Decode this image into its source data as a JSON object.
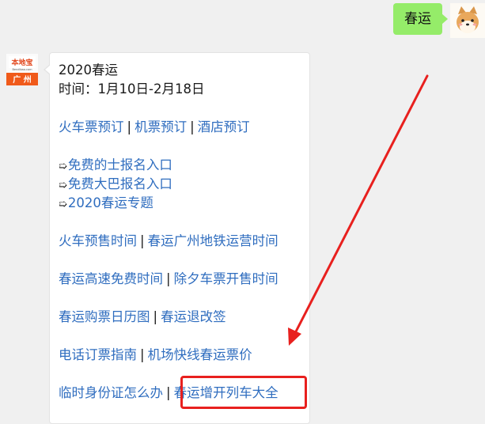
{
  "outgoing": {
    "text": "春运"
  },
  "bot_avatar": {
    "brand": "本地宝",
    "domain": "Bendibao.com",
    "city": "广 州"
  },
  "message": {
    "title": "2020春运",
    "date_line": "时间：1月10日-2月18日",
    "booking_links": [
      "火车票预订",
      "机票预订",
      "酒店预订"
    ],
    "separator": "|",
    "arrow_symbol": "➯",
    "entries": [
      "免费的士报名入口",
      "免费大巴报名入口",
      "2020春运专题"
    ],
    "link_rows": [
      [
        "火车预售时间",
        "春运广州地铁运营时间"
      ],
      [
        "春运高速免费时间",
        "除夕车票开售时间"
      ],
      [
        "春运购票日历图",
        "春运退改签"
      ],
      [
        "电话订票指南",
        "机场快线春运票价"
      ],
      [
        "临时身份证怎么办",
        "春运增开列车大全"
      ]
    ]
  },
  "colors": {
    "link": "#2f6dbf",
    "outgoing_bubble": "#95ec69",
    "highlight": "#e8201e",
    "background": "#f0f0f0"
  }
}
